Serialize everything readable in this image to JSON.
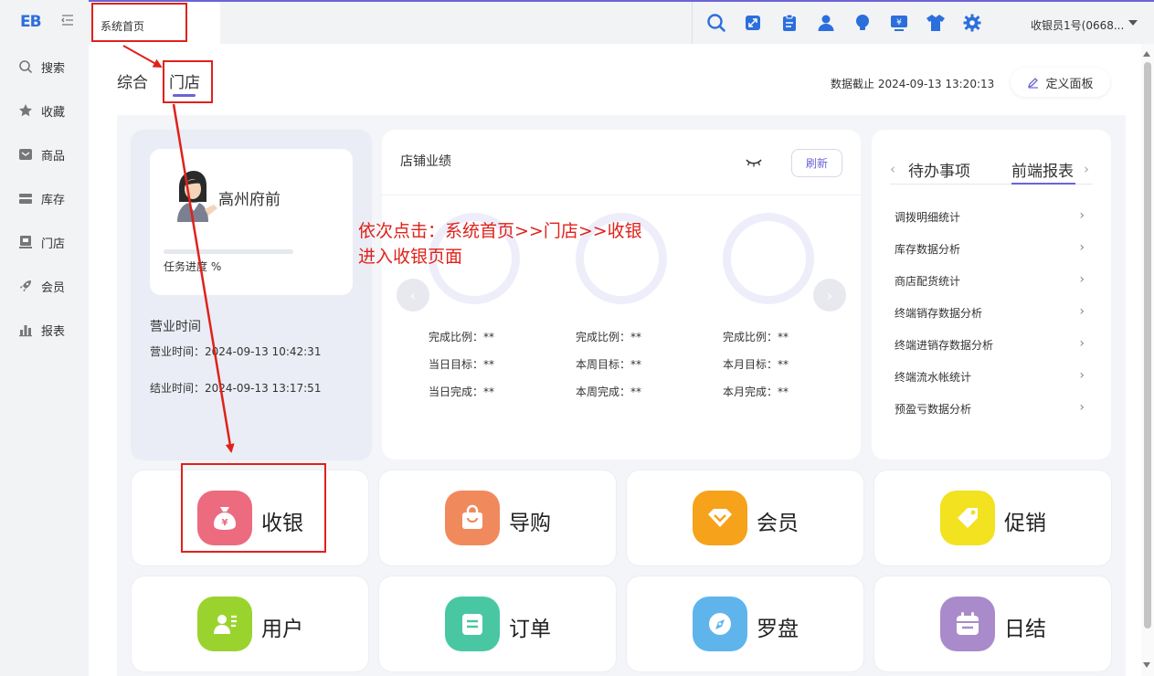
{
  "app": {
    "logo": "EB"
  },
  "sidebar": {
    "items": [
      {
        "label": "搜索",
        "icon": "search-icon"
      },
      {
        "label": "收藏",
        "icon": "star-icon"
      },
      {
        "label": "商品",
        "icon": "goods-icon"
      },
      {
        "label": "库存",
        "icon": "inventory-icon"
      },
      {
        "label": "门店",
        "icon": "store-icon"
      },
      {
        "label": "会员",
        "icon": "rocket-icon"
      },
      {
        "label": "报表",
        "icon": "bar-chart-icon"
      }
    ]
  },
  "topbar": {
    "active_tab": "系统首页",
    "user": "收银员1号(0668...",
    "accent": "#2b6fdc"
  },
  "header": {
    "segments": [
      "综合",
      "门店"
    ],
    "active_segment": "门店",
    "data_cutoff": "数据截止 2024-09-13 13:20:13",
    "define_panel": "定义面板"
  },
  "store": {
    "name": "高州府前",
    "progress_label": "任务进度 %",
    "biz_title": "营业时间",
    "open_time": "营业时间：2024-09-13 10:42:31",
    "close_time": "结业时间：2024-09-13 13:17:51"
  },
  "performance": {
    "title": "店铺业绩",
    "refresh": "刷新",
    "columns": [
      {
        "ratio": "完成比例：**",
        "target": "当日目标：**",
        "done": "当日完成：**"
      },
      {
        "ratio": "完成比例：**",
        "target": "本周目标：**",
        "done": "本周完成：**"
      },
      {
        "ratio": "完成比例：**",
        "target": "本月目标：**",
        "done": "本月完成：**"
      }
    ]
  },
  "reports": {
    "tabs": [
      "待办事项",
      "前端报表"
    ],
    "active_tab": "前端报表",
    "items": [
      "调拨明细统计",
      "库存数据分析",
      "商店配货统计",
      "终端销存数据分析",
      "终端进销存数据分析",
      "终端流水帐统计",
      "预盈亏数据分析"
    ]
  },
  "tiles": [
    {
      "label": "收银",
      "icon": "money-bag-icon",
      "color": "#ec6b7f"
    },
    {
      "label": "导购",
      "icon": "shopping-bag-icon",
      "color": "#f08a5d"
    },
    {
      "label": "会员",
      "icon": "diamond-icon",
      "color": "#f7a21b"
    },
    {
      "label": "促销",
      "icon": "tag-icon",
      "color": "#f2e21f"
    },
    {
      "label": "用户",
      "icon": "user-card-icon",
      "color": "#9bd32e"
    },
    {
      "label": "订单",
      "icon": "order-icon",
      "color": "#49c7a3"
    },
    {
      "label": "罗盘",
      "icon": "compass-icon",
      "color": "#5fb4ec"
    },
    {
      "label": "日结",
      "icon": "calendar-icon",
      "color": "#a98bcb"
    }
  ],
  "annotation": {
    "line1": "依次点击：系统首页>>门店>>收银",
    "line2": "进入收银页面",
    "color": "#e0211a"
  }
}
